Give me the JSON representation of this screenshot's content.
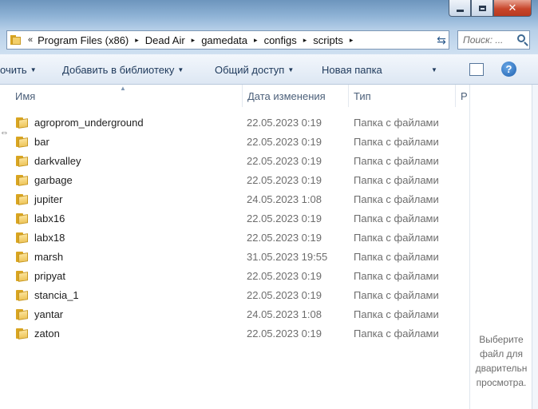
{
  "window": {
    "close_glyph": "✕"
  },
  "address": {
    "overflow_glyph": "«",
    "separator_glyph": "▸",
    "crumbs": [
      "Program Files (x86)",
      "Dead Air",
      "gamedata",
      "configs",
      "scripts"
    ],
    "refresh_glyph": "⇆"
  },
  "search": {
    "placeholder": "Поиск: ..."
  },
  "toolbar": {
    "organize_label": "очить",
    "library_label": "Добавить в библиотеку",
    "share_label": "Общий доступ",
    "new_folder_label": "Новая папка",
    "help_glyph": "?"
  },
  "columns": {
    "name": "Имя",
    "date": "Дата изменения",
    "type": "Тип",
    "size_partial": "Р"
  },
  "files": [
    {
      "name": "agroprom_underground",
      "date": "22.05.2023 0:19",
      "type": "Папка с файлами"
    },
    {
      "name": "bar",
      "date": "22.05.2023 0:19",
      "type": "Папка с файлами"
    },
    {
      "name": "darkvalley",
      "date": "22.05.2023 0:19",
      "type": "Папка с файлами"
    },
    {
      "name": "garbage",
      "date": "22.05.2023 0:19",
      "type": "Папка с файлами"
    },
    {
      "name": "jupiter",
      "date": "24.05.2023 1:08",
      "type": "Папка с файлами"
    },
    {
      "name": "labx16",
      "date": "22.05.2023 0:19",
      "type": "Папка с файлами"
    },
    {
      "name": "labx18",
      "date": "22.05.2023 0:19",
      "type": "Папка с файлами"
    },
    {
      "name": "marsh",
      "date": "31.05.2023 19:55",
      "type": "Папка с файлами"
    },
    {
      "name": "pripyat",
      "date": "22.05.2023 0:19",
      "type": "Папка с файлами"
    },
    {
      "name": "stancia_1",
      "date": "22.05.2023 0:19",
      "type": "Папка с файлами"
    },
    {
      "name": "yantar",
      "date": "24.05.2023 1:08",
      "type": "Папка с файлами"
    },
    {
      "name": "zaton",
      "date": "22.05.2023 0:19",
      "type": "Папка с файлами"
    }
  ],
  "preview": {
    "message_lines": [
      "Выберите",
      "файл для",
      "дварительн",
      "просмотра."
    ]
  },
  "icons": {
    "folder": "folder-icon",
    "search": "search-icon",
    "help": "help-icon",
    "views": "views-icon",
    "preview_pane": "preview-pane-icon"
  },
  "colors": {
    "folder": "#e8b935",
    "link_text": "#1e395b",
    "muted_text": "#6d6d6d",
    "close_button": "#c8462b"
  }
}
